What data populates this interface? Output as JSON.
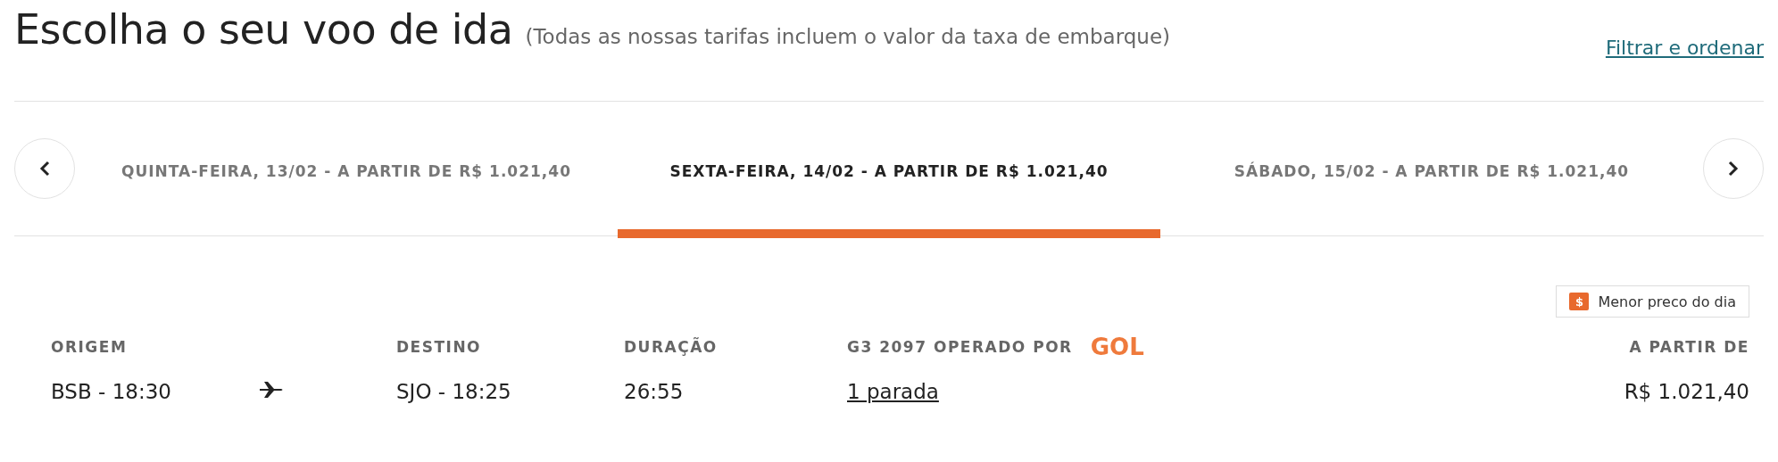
{
  "header": {
    "title": "Escolha o seu voo de ida",
    "subtitle": "(Todas as nossas tarifas incluem o valor da taxa de embarque)",
    "filter_link": "Filtrar e ordenar"
  },
  "date_tabs": [
    {
      "label": "QUINTA-FEIRA, 13/02 - A PARTIR DE R$ 1.021,40",
      "selected": false
    },
    {
      "label": "SEXTA-FEIRA, 14/02 - A PARTIR DE R$ 1.021,40",
      "selected": true
    },
    {
      "label": "SÁBADO, 15/02 - A PARTIR DE R$ 1.021,40",
      "selected": false
    }
  ],
  "badge": {
    "symbol": "$",
    "label": "Menor preco do dia"
  },
  "flight": {
    "origin_label": "ORIGEM",
    "origin": "BSB - 18:30",
    "destination_label": "DESTINO",
    "destination": "SJO - 18:25",
    "duration_label": "DURAÇÃO",
    "duration": "26:55",
    "operator_label": "G3 2097 OPERADO POR",
    "operator_logo": "GOL",
    "stops": "1 parada",
    "price_label": "A PARTIR DE",
    "price": "R$ 1.021,40"
  }
}
